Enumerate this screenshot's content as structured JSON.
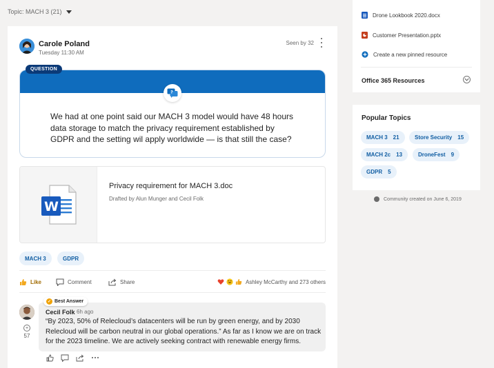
{
  "topic_bar": {
    "label": "Topic: MACH 3 (21)"
  },
  "post": {
    "author": "Carole Poland",
    "time": "Tuesday 11:30 AM",
    "seen_by": "Seen by 32",
    "question_badge": "QUESTION",
    "question_text": "We had at one point said our MACH 3 model would have 48 hours data storage to match the privacy requirement established by GDPR and the setting wil apply worldwide — is that still the case?",
    "attachment": {
      "title": "Privacy requirement for MACH 3.doc",
      "subtitle": "Drafted by Alun Munger and Cecil Folk",
      "icon": "word-doc-icon"
    },
    "tags": [
      "MACH 3",
      "GDPR"
    ],
    "actions": {
      "like": "Like",
      "comment": "Comment",
      "share": "Share"
    },
    "reactions_summary": "Ashley McCarthy and 273 others"
  },
  "reply": {
    "badge": "Best Answer",
    "author": "Cecil Folk",
    "time": "6h ago",
    "votes": "57",
    "text": "“By 2023, 50% of Relecloud’s datacenters will be run by green energy, and by 2030 Relecloud will be carbon neutral in our global operations.” As far as I know we are on track for the 2023 timeline. We are actively seeking contract with renewable energy firms."
  },
  "sidebar": {
    "pinned": [
      {
        "label": "Drone Lookbook 2020.docx",
        "icon": "word-file-icon"
      },
      {
        "label": "Customer Presentation.pptx",
        "icon": "powerpoint-file-icon"
      },
      {
        "label": "Create a new pinned resource",
        "icon": "add-icon"
      }
    ],
    "office_resources": "Office 365 Resources",
    "popular_topics": {
      "title": "Popular Topics",
      "items": [
        {
          "name": "MACH 3",
          "count": "21"
        },
        {
          "name": "Store Security",
          "count": "15"
        },
        {
          "name": "MACH 2c",
          "count": "13"
        },
        {
          "name": "DroneFest",
          "count": "9"
        },
        {
          "name": "GDPR",
          "count": "5"
        }
      ]
    },
    "community_created": "Community created on June 6, 2019"
  },
  "colors": {
    "accent": "#0f6cbd",
    "tag_bg": "#e8f1fa",
    "tag_text": "#115ea3",
    "best_answer": "#f0a30a"
  }
}
